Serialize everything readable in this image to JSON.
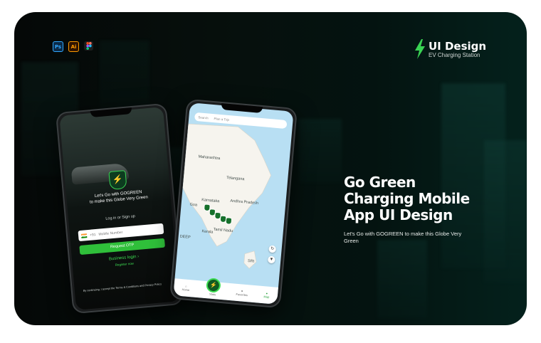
{
  "tools": [
    "Ps",
    "Ai"
  ],
  "brand": {
    "title": "UI Design",
    "subtitle": "EV Charging Station",
    "accent": "#39d353"
  },
  "hero": {
    "line1": "Go Green",
    "line2": "Charging Mobile",
    "line3": "App UI Design",
    "tagline": "Let's Go with GOGREEN  to make this Globe Very Green"
  },
  "login": {
    "welcome1": "Let's Go with GOGREEN",
    "welcome2": "to make this Globe Very Green",
    "divider": "Log in or Sign up",
    "country_code": "+91",
    "phone_placeholder": "Mobile Number",
    "request_otp": "Request OTP",
    "business_login": "Business login ›",
    "register_now": "Register now",
    "terms": "By continuing, I accept the Terms & Conditions and Privacy Policy"
  },
  "map": {
    "search_placeholder": "Search",
    "plan_trip": "Plan a Trip",
    "labels": [
      "Maharashtra",
      "Telangana",
      "Andhra Pradesh",
      "Karnataka",
      "Goa",
      "Tamil Nadu",
      "Kerala",
      "DEEP",
      "SRI"
    ],
    "tabs": [
      "Home",
      "Stats",
      "Favorites",
      "Map"
    ]
  }
}
